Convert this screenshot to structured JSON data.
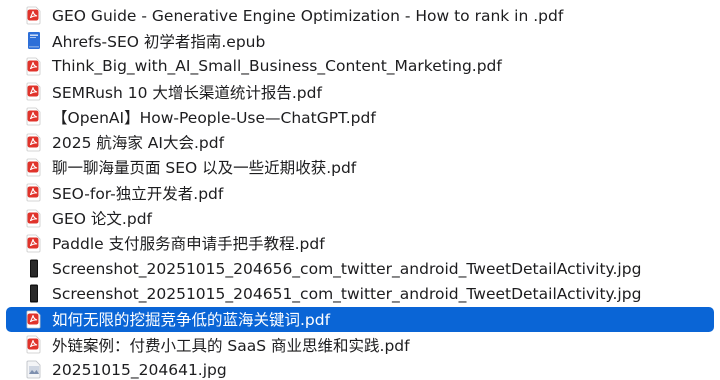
{
  "files": [
    {
      "name": "GEO Guide - Generative Engine Optimization - How to rank in .pdf",
      "icon": "pdf-icon",
      "selected": false
    },
    {
      "name": "Ahrefs-SEO 初学者指南.epub",
      "icon": "epub-icon",
      "selected": false
    },
    {
      "name": "Think_Big_with_AI_Small_Business_Content_Marketing.pdf",
      "icon": "pdf-icon",
      "selected": false
    },
    {
      "name": "SEMRush 10 大增长渠道统计报告.pdf",
      "icon": "pdf-icon",
      "selected": false
    },
    {
      "name": "【OpenAI】How-People-Use—ChatGPT.pdf",
      "icon": "pdf-icon",
      "selected": false
    },
    {
      "name": "2025 航海家 AI大会.pdf",
      "icon": "pdf-icon",
      "selected": false
    },
    {
      "name": "聊一聊海量页面 SEO 以及一些近期收获.pdf",
      "icon": "pdf-icon",
      "selected": false
    },
    {
      "name": "SEO-for-独立开发者.pdf",
      "icon": "pdf-icon",
      "selected": false
    },
    {
      "name": "GEO 论文.pdf",
      "icon": "pdf-icon",
      "selected": false
    },
    {
      "name": "Paddle 支付服务商申请手把手教程.pdf",
      "icon": "pdf-icon",
      "selected": false
    },
    {
      "name": "Screenshot_20251015_204656_com_twitter_android_TweetDetailActivity.jpg",
      "icon": "phone-screenshot-icon",
      "selected": false
    },
    {
      "name": "Screenshot_20251015_204651_com_twitter_android_TweetDetailActivity.jpg",
      "icon": "phone-screenshot-icon",
      "selected": false
    },
    {
      "name": "如何无限的挖掘竞争低的蓝海关键词.pdf",
      "icon": "pdf-icon",
      "selected": true
    },
    {
      "name": "外链案例：付费小工具的 SaaS 商业思维和实践.pdf",
      "icon": "pdf-icon",
      "selected": false
    },
    {
      "name": "20251015_204641.jpg",
      "icon": "image-icon",
      "selected": false
    }
  ],
  "colors": {
    "selection": "#0a65d6",
    "pdf_red": "#e0332b",
    "epub_blue": "#2d6fd8"
  }
}
